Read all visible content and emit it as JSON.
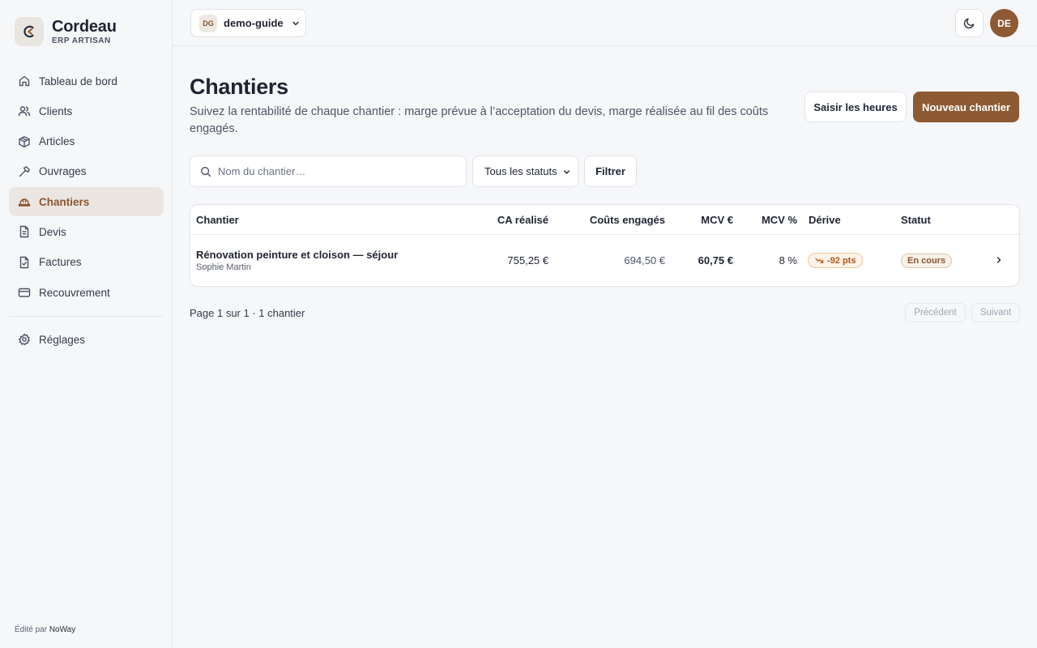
{
  "brand": {
    "name": "Cordeau",
    "subtitle": "ERP ARTISAN"
  },
  "sidebar": {
    "items": [
      {
        "label": "Tableau de bord",
        "icon": "home-icon"
      },
      {
        "label": "Clients",
        "icon": "users-icon"
      },
      {
        "label": "Articles",
        "icon": "package-icon"
      },
      {
        "label": "Ouvrages",
        "icon": "hammer-icon"
      },
      {
        "label": "Chantiers",
        "icon": "hardhat-icon",
        "active": true
      },
      {
        "label": "Devis",
        "icon": "document-icon"
      },
      {
        "label": "Factures",
        "icon": "invoice-icon"
      },
      {
        "label": "Recouvrement",
        "icon": "credit-card-icon"
      }
    ],
    "settings": {
      "label": "Réglages",
      "icon": "gear-icon"
    },
    "footer_prefix": "Édité par",
    "footer_brand": "NoWay"
  },
  "topbar": {
    "org_badge": "DG",
    "org_name": "demo-guide",
    "avatar_initials": "DE"
  },
  "page": {
    "title": "Chantiers",
    "description": "Suivez la rentabilité de chaque chantier : marge prévue à l’acceptation du devis, marge réalisée au fil des coûts engagés.",
    "btn_hours": "Saisir les heures",
    "btn_new": "Nouveau chantier"
  },
  "filters": {
    "search_placeholder": "Nom du chantier…",
    "status_selected": "Tous les statuts",
    "filter_button": "Filtrer"
  },
  "table": {
    "columns": [
      "Chantier",
      "CA réalisé",
      "Coûts engagés",
      "MCV €",
      "MCV %",
      "Dérive",
      "Statut"
    ],
    "rows": [
      {
        "name": "Rénovation peinture et cloison — séjour",
        "client": "Sophie Martin",
        "ca": "755,25 €",
        "costs": "694,50 €",
        "mcv_eur": "60,75 €",
        "mcv_pct": "8 %",
        "drift": "-92 pts",
        "status": "En cours"
      }
    ]
  },
  "pager": {
    "info": "Page 1 sur 1 · 1 chantier",
    "prev": "Précédent",
    "next": "Suivant"
  },
  "colors": {
    "accent": "#8e5a33",
    "warning": "#b4571a"
  }
}
